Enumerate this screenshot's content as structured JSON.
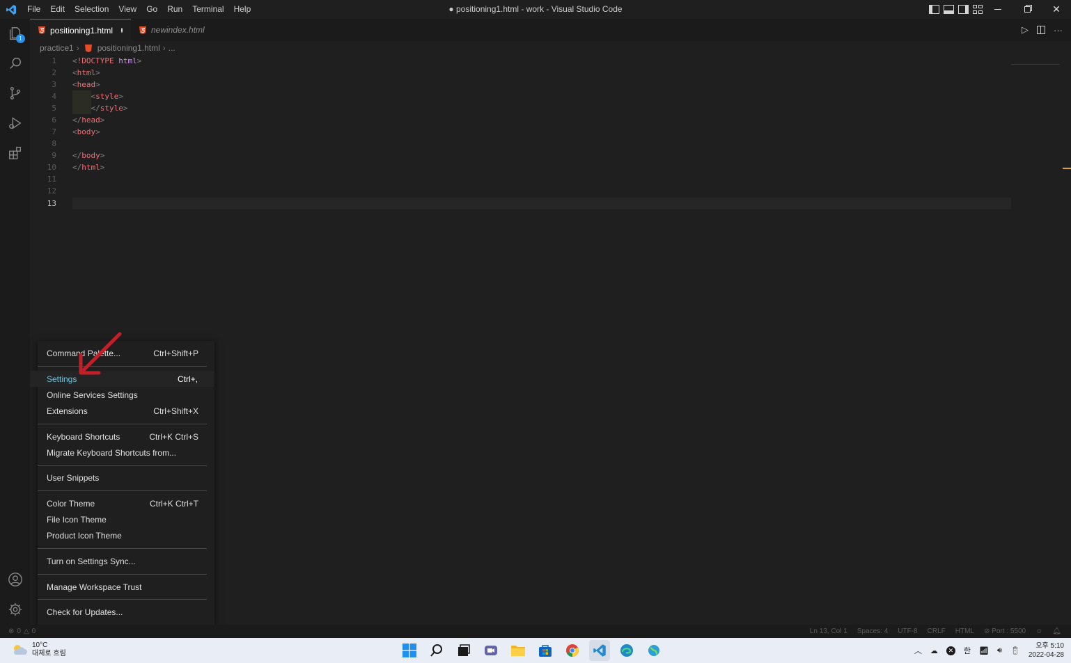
{
  "titlebar": {
    "menu": [
      "File",
      "Edit",
      "Selection",
      "View",
      "Go",
      "Run",
      "Terminal",
      "Help"
    ],
    "window_title": "● positioning1.html - work - Visual Studio Code"
  },
  "activitybar": {
    "explorer_badge": "1"
  },
  "tabs": [
    {
      "label": "positioning1.html",
      "dirty": true
    },
    {
      "label": "newindex.html",
      "dirty": false
    }
  ],
  "breadcrumb": [
    "practice1",
    "positioning1.html",
    "..."
  ],
  "editor": {
    "current_line": 13,
    "lines": [
      {
        "n": "1"
      },
      {
        "n": "2"
      },
      {
        "n": "3"
      },
      {
        "n": "4"
      },
      {
        "n": "5"
      },
      {
        "n": "6"
      },
      {
        "n": "7"
      },
      {
        "n": "8"
      },
      {
        "n": "9"
      },
      {
        "n": "10"
      },
      {
        "n": "11"
      },
      {
        "n": "12"
      },
      {
        "n": "13"
      }
    ],
    "code": {
      "l1_doctype": "!DOCTYPE",
      "l1_html": "html",
      "html": "html",
      "head": "head",
      "style": "style",
      "body": "body"
    }
  },
  "menu": {
    "items": [
      {
        "label": "Command Palette...",
        "shortcut": "Ctrl+Shift+P"
      },
      {
        "label": "Settings",
        "shortcut": "Ctrl+,"
      },
      {
        "label": "Online Services Settings",
        "shortcut": ""
      },
      {
        "label": "Extensions",
        "shortcut": "Ctrl+Shift+X"
      },
      {
        "label": "Keyboard Shortcuts",
        "shortcut": "Ctrl+K Ctrl+S"
      },
      {
        "label": "Migrate Keyboard Shortcuts from...",
        "shortcut": ""
      },
      {
        "label": "User Snippets",
        "shortcut": ""
      },
      {
        "label": "Color Theme",
        "shortcut": "Ctrl+K Ctrl+T"
      },
      {
        "label": "File Icon Theme",
        "shortcut": ""
      },
      {
        "label": "Product Icon Theme",
        "shortcut": ""
      },
      {
        "label": "Turn on Settings Sync...",
        "shortcut": ""
      },
      {
        "label": "Manage Workspace Trust",
        "shortcut": ""
      },
      {
        "label": "Check for Updates...",
        "shortcut": ""
      }
    ],
    "highlighted": "Settings"
  },
  "statusbar": {
    "errors": "0",
    "warnings": "0",
    "position": "Ln 13, Col 1",
    "spaces": "Spaces: 4",
    "encoding": "UTF-8",
    "eol": "CRLF",
    "language": "HTML",
    "port": "Port : 5500"
  },
  "taskbar": {
    "weather_temp": "10°C",
    "weather_desc": "대체로 흐림",
    "ime": "한",
    "time": "오후 5:10",
    "date": "2022-04-28"
  },
  "colors": {
    "accent": "#2f80ed",
    "tag": "#f07178",
    "keyword": "#c792ea",
    "arrow": "#c0202a",
    "settings_label": "#6fc3df"
  }
}
